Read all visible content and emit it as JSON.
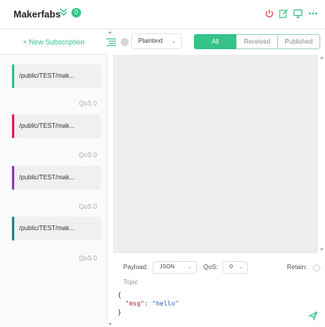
{
  "header": {
    "title": "Makerfabs",
    "connection_count": "0",
    "icons": [
      "chevron-double-down-icon",
      "power-icon",
      "edit-icon",
      "monitor-icon",
      "more-icon"
    ],
    "accent": "#34c388",
    "power_color": "#e5484d"
  },
  "sidebar": {
    "new_subscription": "+ New Subscription",
    "subscriptions": [
      {
        "topic": "/public/TEST/mak...",
        "qos": "QoS 0",
        "color": "#34c388"
      },
      {
        "topic": "/public/TEST/mak...",
        "qos": "QoS 0",
        "color": "#e0245e"
      },
      {
        "topic": "/public/TEST/mak...",
        "qos": "QoS 0",
        "color": "#8a3fb8"
      },
      {
        "topic": "/public/TEST/mak...",
        "qos": "QoS 0",
        "color": "#1e8a8a"
      }
    ]
  },
  "toolbar": {
    "format_selected": "Plaintext",
    "filters": [
      "All",
      "Received",
      "Published"
    ],
    "active_filter": "All"
  },
  "publish": {
    "payload_label": "Payload:",
    "payload_format": "JSON",
    "qos_label": "QoS:",
    "qos_value": "0",
    "retain_label": "Retain:",
    "topic_placeholder": "Topic",
    "payload_lines": [
      "{",
      "\"msg\": \"hello\"",
      "}"
    ],
    "payload_key": "\"msg\"",
    "payload_value": "\"hello\""
  }
}
